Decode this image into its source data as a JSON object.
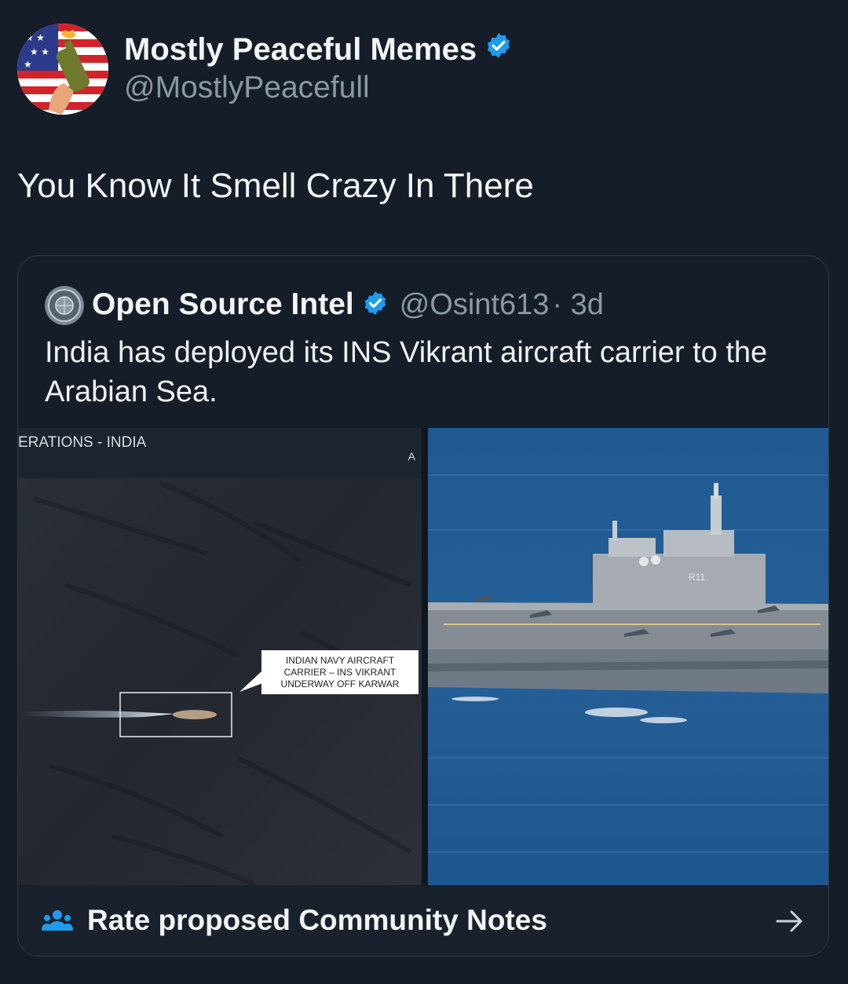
{
  "author": {
    "display_name": "Mostly Peaceful Memes",
    "handle": "@MostlyPeacefull",
    "avatar_icon": "flag-molotov-avatar",
    "verified": true,
    "verified_color": "#1d9bf0"
  },
  "tweet": {
    "text": "You Know It Smell Crazy In There"
  },
  "quoted_tweet": {
    "display_name": "Open Source Intel",
    "handle": "@Osint613",
    "time": "· 3d",
    "avatar_icon": "globe-seal-avatar",
    "verified": true,
    "text": "India has deployed its INS Vikrant aircraft carrier to the Arabian Sea.",
    "media": {
      "left_image": {
        "header_text": "ERATIONS - INDIA",
        "corner_letter": "A",
        "callout_lines": [
          "INDIAN NAVY AIRCRAFT",
          "CARRIER – INS VIKRANT",
          "UNDERWAY OFF KARWAR"
        ]
      },
      "right_image": {
        "description_icon": "aircraft-carrier-photo",
        "hull_number": "R11"
      }
    }
  },
  "community_notes": {
    "label": "Rate proposed Community Notes",
    "icon": "people-icon",
    "arrow_icon": "arrow-right-icon"
  },
  "colors": {
    "background": "#151d28",
    "accent": "#1d9bf0",
    "secondary_text": "#8b98a5"
  }
}
